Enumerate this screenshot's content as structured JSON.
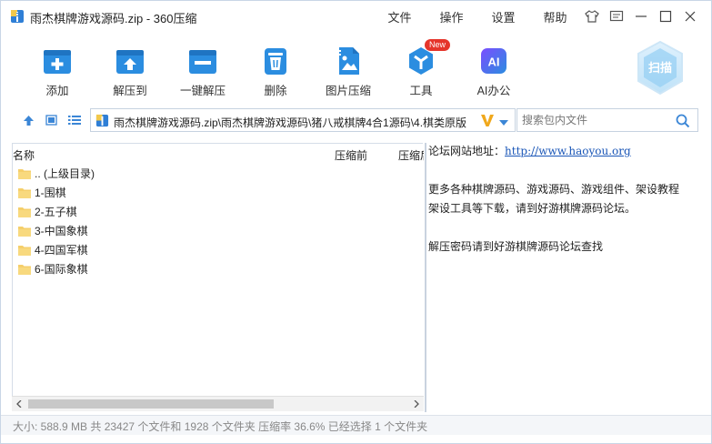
{
  "window": {
    "title": "雨杰棋牌游戏源码.zip - 360压缩",
    "menu": [
      "文件",
      "操作",
      "设置",
      "帮助"
    ]
  },
  "toolbar": {
    "items": [
      {
        "label": "添加",
        "icon": "add-icon"
      },
      {
        "label": "解压到",
        "icon": "extract-to-icon"
      },
      {
        "label": "一键解压",
        "icon": "one-click-extract-icon"
      },
      {
        "label": "删除",
        "icon": "trash-icon"
      },
      {
        "label": "图片压缩",
        "icon": "image-compress-icon"
      },
      {
        "label": "工具",
        "icon": "tools-icon",
        "badge": "New"
      },
      {
        "label": "AI办公",
        "icon": "ai-office-icon",
        "icon_text": "AI"
      }
    ],
    "scan_label": "扫描"
  },
  "nav": {
    "path": "雨杰棋牌游戏源码.zip\\雨杰棋牌游戏源码\\猪八戒棋牌4合1源码\\4.棋类原版",
    "search_placeholder": "搜索包内文件"
  },
  "filelist": {
    "columns": [
      "名称",
      "压缩前",
      "压缩后"
    ],
    "rows": [
      {
        "name": ".. (上级目录)"
      },
      {
        "name": "1-围棋"
      },
      {
        "name": "2-五子棋"
      },
      {
        "name": "3-中国象棋"
      },
      {
        "name": "4-四国军棋"
      },
      {
        "name": "6-国际象棋"
      }
    ]
  },
  "note": {
    "forum_label": "论坛网站地址：",
    "forum_url": "http://www.haoyou.org",
    "line1": "更多各种棋牌源码、游戏源码、游戏组件、架设教程",
    "line2": "架设工具等下载，请到好游棋牌源码论坛。",
    "line3": "解压密码请到好游棋牌源码论坛查找"
  },
  "status": {
    "text": "大小: 588.9 MB 共 23427 个文件和 1928 个文件夹 压缩率 36.6% 已经选择 1 个文件夹"
  },
  "colors": {
    "accent": "#2b8de0",
    "folder": "#f5cf6b",
    "badge": "#e5352b",
    "link": "#1a56b7"
  }
}
